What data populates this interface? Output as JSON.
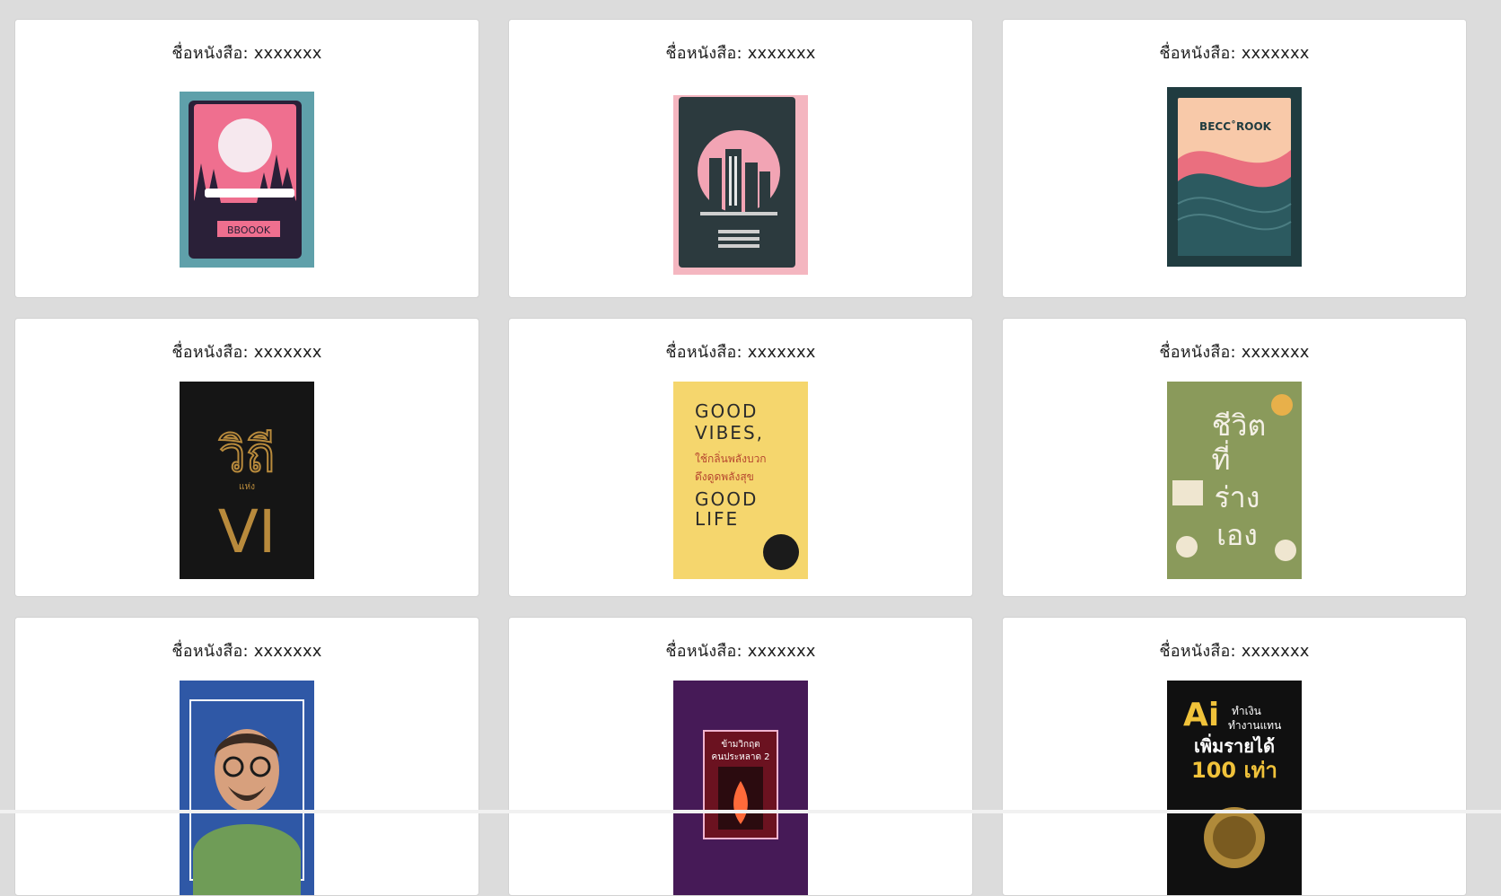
{
  "books": [
    {
      "title": "ชื่อหนังสือ: xxxxxxx",
      "cover_text": "BBOOOK"
    },
    {
      "title": "ชื่อหนังสือ: xxxxxxx",
      "cover_text": ""
    },
    {
      "title": "ชื่อหนังสือ: xxxxxxx",
      "cover_text": "BECC˚ROOK"
    },
    {
      "title": "ชื่อหนังสือ: xxxxxxx",
      "cover_text": [
        "วิถี",
        "แห่ง",
        "VI"
      ]
    },
    {
      "title": "ชื่อหนังสือ: xxxxxxx",
      "cover_text": [
        "GOOD",
        "VIBES,",
        "ใช้กลิ่นพลังบวก",
        "ดึงดูดพลังสุข",
        "GOOD",
        "LIFE"
      ]
    },
    {
      "title": "ชื่อหนังสือ: xxxxxxx",
      "cover_text": [
        "ชีวิต",
        "ที่",
        "ร่าง",
        "เอง"
      ]
    },
    {
      "title": "ชื่อหนังสือ: xxxxxxx",
      "cover_text": ""
    },
    {
      "title": "ชื่อหนังสือ: xxxxxxx",
      "cover_text": [
        "ข้ามวิกฤต",
        "คนประหลาด 2"
      ]
    },
    {
      "title": "ชื่อหนังสือ: xxxxxxx",
      "cover_text": [
        "Ai",
        "ทำเงิน",
        "ทำงานแทน",
        "เพิ่มรายได้",
        "100 เท่า"
      ]
    }
  ]
}
